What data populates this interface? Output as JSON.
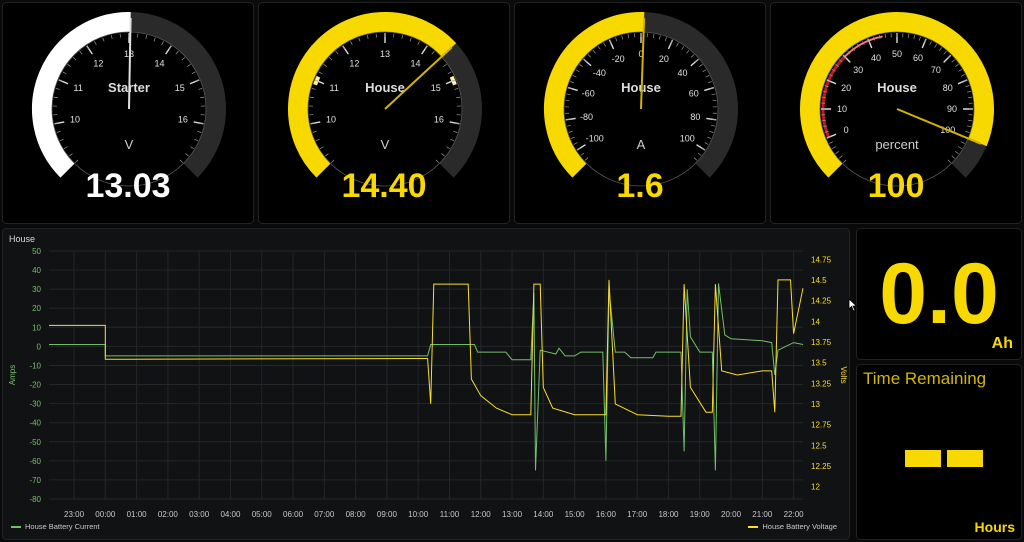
{
  "gauges": [
    {
      "title": "Starter",
      "unit": "V",
      "value_text": "13.03",
      "min": 9,
      "max": 17,
      "value": 13.03,
      "ticks": [
        "10",
        "11",
        "12",
        "13",
        "14",
        "15",
        "16"
      ],
      "tick_values": [
        10,
        11,
        12,
        13,
        14,
        15,
        16
      ],
      "color": "#ffffff",
      "band": null
    },
    {
      "title": "House",
      "unit": "V",
      "value_text": "14.40",
      "min": 9,
      "max": 17,
      "value": 14.4,
      "ticks": [
        "10",
        "11",
        "12",
        "13",
        "14",
        "15",
        "16"
      ],
      "tick_values": [
        10,
        11,
        12,
        13,
        14,
        15,
        16
      ],
      "color": "#f7d900",
      "band": [
        [
          10.9,
          11.1
        ],
        [
          14.9,
          15.1
        ]
      ]
    },
    {
      "title": "House",
      "unit": "A",
      "value_text": "1.6",
      "min": -110,
      "max": 110,
      "value": 1.6,
      "ticks": [
        "-100",
        "-80",
        "-60",
        "-40",
        "-20",
        "0",
        "20",
        "40",
        "60",
        "80",
        "100"
      ],
      "tick_values": [
        -100,
        -80,
        -60,
        -40,
        -20,
        0,
        20,
        40,
        60,
        80,
        100
      ],
      "color": "#f7d900",
      "band": null
    },
    {
      "title": "House",
      "unit": "percent",
      "value_text": "100",
      "min": -10,
      "max": 110,
      "value": 100,
      "ticks": [
        "0",
        "10",
        "20",
        "30",
        "40",
        "50",
        "60",
        "70",
        "80",
        "90",
        "100"
      ],
      "tick_values": [
        0,
        10,
        20,
        30,
        40,
        50,
        60,
        70,
        80,
        90,
        100
      ],
      "color": "#f7d900",
      "band": "red-low"
    }
  ],
  "chart_data": {
    "type": "line",
    "title": "House",
    "ylabel": "Amps",
    "y2label": "Volts",
    "ylim": [
      -80,
      50
    ],
    "y2lim": [
      11.85,
      14.85
    ],
    "y_ticks": [
      50,
      40,
      30,
      20,
      10,
      0,
      -10,
      -20,
      -30,
      -40,
      -50,
      -60,
      -70,
      -80
    ],
    "y2_ticks": [
      "14.75",
      "14.5",
      "14.25",
      "14",
      "13.75",
      "13.5",
      "13.25",
      "13",
      "12.75",
      "12.5",
      "12.25",
      "12"
    ],
    "x_ticks": [
      "23:00",
      "00:00",
      "01:00",
      "02:00",
      "03:00",
      "04:00",
      "05:00",
      "06:00",
      "07:00",
      "08:00",
      "09:00",
      "10:00",
      "11:00",
      "12:00",
      "13:00",
      "14:00",
      "15:00",
      "16:00",
      "17:00",
      "18:00",
      "19:00",
      "20:00",
      "21:00",
      "22:00"
    ],
    "x_start_hour": 22.2,
    "x_end_hour": 46.3,
    "series": [
      {
        "name": "House Battery Current",
        "color": "#73bf69",
        "axis": "left",
        "points": [
          [
            22.2,
            1
          ],
          [
            24.0,
            1
          ],
          [
            24.0,
            -5
          ],
          [
            34.0,
            -5
          ],
          [
            34.3,
            -5
          ],
          [
            34.4,
            1
          ],
          [
            35.8,
            1
          ],
          [
            35.9,
            -3
          ],
          [
            36.8,
            -3
          ],
          [
            37.0,
            -7
          ],
          [
            37.6,
            -7
          ],
          [
            37.7,
            28
          ],
          [
            37.75,
            -65
          ],
          [
            37.9,
            -2
          ],
          [
            38.4,
            -4
          ],
          [
            38.5,
            -1
          ],
          [
            38.7,
            -5
          ],
          [
            39.0,
            -5
          ],
          [
            39.2,
            -3
          ],
          [
            39.9,
            -3
          ],
          [
            40.0,
            -60
          ],
          [
            40.1,
            30
          ],
          [
            40.3,
            -3
          ],
          [
            40.6,
            -3
          ],
          [
            40.8,
            -6
          ],
          [
            41.5,
            -6
          ],
          [
            41.6,
            -3
          ],
          [
            42.4,
            -3
          ],
          [
            42.5,
            -55
          ],
          [
            42.6,
            30
          ],
          [
            42.7,
            5
          ],
          [
            43.0,
            -3
          ],
          [
            43.4,
            -3
          ],
          [
            43.5,
            -65
          ],
          [
            43.6,
            33
          ],
          [
            43.8,
            6
          ],
          [
            44.0,
            4
          ],
          [
            45.0,
            3
          ],
          [
            45.3,
            2
          ],
          [
            45.4,
            -15
          ],
          [
            45.5,
            -2
          ],
          [
            46.0,
            2
          ],
          [
            46.3,
            1
          ]
        ]
      },
      {
        "name": "House Battery Voltage",
        "color": "#fade2a",
        "axis": "right",
        "points": [
          [
            22.2,
            13.95
          ],
          [
            24.0,
            13.95
          ],
          [
            24.0,
            13.54
          ],
          [
            34.0,
            13.55
          ],
          [
            34.3,
            13.55
          ],
          [
            34.4,
            13.0
          ],
          [
            34.5,
            14.45
          ],
          [
            35.6,
            14.45
          ],
          [
            35.7,
            13.3
          ],
          [
            36.0,
            13.1
          ],
          [
            36.5,
            12.95
          ],
          [
            37.0,
            12.87
          ],
          [
            37.6,
            12.87
          ],
          [
            37.7,
            14.45
          ],
          [
            37.9,
            14.45
          ],
          [
            38.0,
            13.2
          ],
          [
            38.3,
            12.95
          ],
          [
            39.0,
            12.87
          ],
          [
            40.0,
            12.87
          ],
          [
            40.1,
            14.5
          ],
          [
            40.3,
            13.0
          ],
          [
            41.0,
            12.87
          ],
          [
            42.0,
            12.85
          ],
          [
            42.4,
            12.85
          ],
          [
            42.5,
            14.45
          ],
          [
            42.7,
            13.2
          ],
          [
            43.2,
            12.9
          ],
          [
            43.4,
            12.9
          ],
          [
            43.5,
            14.45
          ],
          [
            43.7,
            13.4
          ],
          [
            44.2,
            13.35
          ],
          [
            45.0,
            13.4
          ],
          [
            45.3,
            13.4
          ],
          [
            45.4,
            12.9
          ],
          [
            45.5,
            14.5
          ],
          [
            45.9,
            14.5
          ],
          [
            46.0,
            13.85
          ],
          [
            46.3,
            14.4
          ]
        ]
      }
    ]
  },
  "stat_ah": {
    "value": "0.0",
    "unit": "Ah"
  },
  "time_remaining": {
    "title": "Time Remaining",
    "unit": "Hours"
  }
}
